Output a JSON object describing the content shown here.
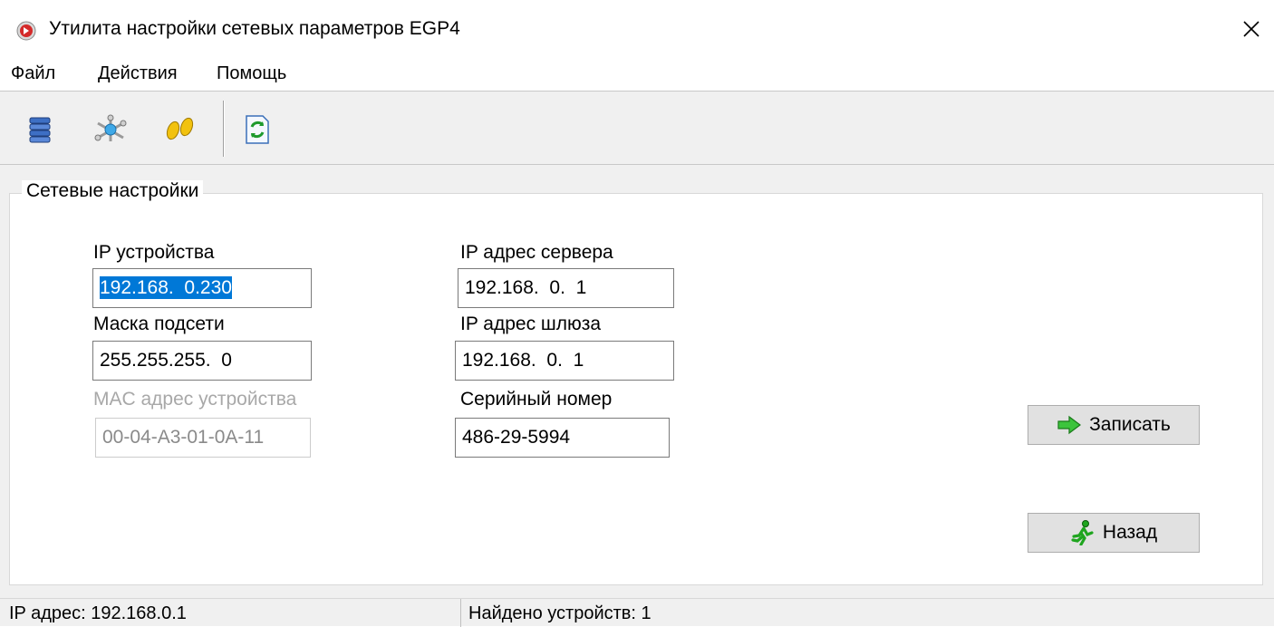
{
  "window": {
    "title": "Утилита настройки сетевых параметров EGP4",
    "close_icon": "×"
  },
  "menu": [
    "Файл",
    "Действия",
    "Помощь"
  ],
  "toolbar": {
    "icons": [
      "database-icon",
      "network-icon",
      "footsteps-icon",
      "refresh-icon"
    ]
  },
  "group": {
    "title": "Сетевые настройки",
    "ip_device": {
      "label": "IP устройства",
      "value": "192.168.  0.230"
    },
    "subnet_mask": {
      "label": "Маска подсети",
      "value": "255.255.255.  0"
    },
    "mac_address": {
      "label": "MAC адрес устройства",
      "value": "00-04-A3-01-0A-11"
    },
    "server_ip": {
      "label": "IP адрес сервера",
      "value": "192.168.  0.  1"
    },
    "gateway_ip": {
      "label": "IP адрес шлюза",
      "value": "192.168.  0.  1"
    },
    "serial": {
      "label": "Серийный номер",
      "value": "486-29-5994"
    },
    "write_button": "Записать",
    "back_button": "Назад"
  },
  "status": {
    "ip": "IP адрес: 192.168.0.1",
    "found": "Найдено устройств: 1"
  },
  "colors": {
    "selection": "#0078d7",
    "toolbar_bg": "#f0f0f0",
    "button_bg": "#e1e1e1"
  }
}
